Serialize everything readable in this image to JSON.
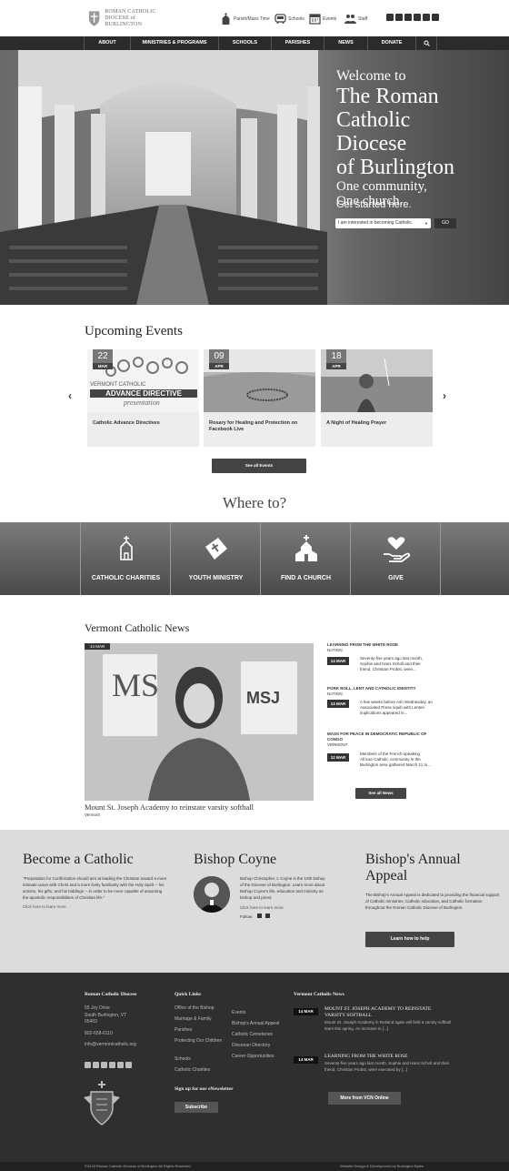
{
  "header": {
    "logo_line1": "ROMAN CATHOLIC",
    "logo_line2": "DIOCESE of BURLINGTON",
    "links": [
      {
        "label": "Parish/Mass Time"
      },
      {
        "label": "Schools"
      },
      {
        "label": "Events"
      },
      {
        "label": "Staff"
      }
    ],
    "social": [
      "youtube-icon",
      "vimeo-icon",
      "instagram-icon",
      "twitter-icon",
      "facebook-icon",
      "flickr-icon"
    ]
  },
  "nav": {
    "items": [
      "ABOUT",
      "MINISTRIES & PROGRAMS",
      "SCHOOLS",
      "PARISHES",
      "NEWS",
      "DONATE"
    ],
    "search_icon": "search-icon"
  },
  "hero": {
    "welcome_to": "Welcome to",
    "line_the_roman": "The Roman",
    "line_catholic": "Catholic",
    "line_diocese": "Diocese",
    "line_of_burlington": "of Burlington",
    "line_community": "One community,",
    "line_church": "One church.",
    "get_started": "Get started here.",
    "select_value": "I am interested in becoming Catholic.",
    "go_label": "GO"
  },
  "events": {
    "title": "Upcoming Events",
    "cards": [
      {
        "day": "22",
        "month": "MAR",
        "title": "Catholic Advance Directives",
        "img_line1": "VERMONT CATHOLIC",
        "img_line2": "ADVANCE DIRECTIVE",
        "img_line3": "presentation"
      },
      {
        "day": "09",
        "month": "APR",
        "title": "Rosary for Healing and Protection on Facebook Live"
      },
      {
        "day": "18",
        "month": "APR",
        "title": "A Night of Healing Prayer"
      }
    ],
    "see_all": "See all Events"
  },
  "where": {
    "title": "Where to?",
    "items": [
      {
        "label": "CATHOLIC CHARITIES",
        "icon": "charities-icon"
      },
      {
        "label": "YOUTH MINISTRY",
        "icon": "bible-icon"
      },
      {
        "label": "FIND A CHURCH",
        "icon": "church-icon"
      },
      {
        "label": "GIVE",
        "icon": "give-heart-icon"
      }
    ]
  },
  "news": {
    "title": "Vermont Catholic News",
    "main": {
      "date": "14 MAR",
      "headline": "Mount St. Joseph Academy to reinstate varsity softball",
      "location": "Vermont"
    },
    "side": [
      {
        "title": "LEARNING FROM THE WHITE ROSE",
        "location": "NATION",
        "date": "14 MAR",
        "text": "Seventy-five years ago last month, Sophie and Hans Scholl and their friend, Christian Probst, were..."
      },
      {
        "title": "PORK ROLL, LENT AND CATHOLIC IDENTITY",
        "location": "NATION",
        "date": "13 MAR",
        "text": "A few weeks before Ash Wednesday, an Associated Press squib with Lenten implications appeared in..."
      },
      {
        "title": "MASS FOR PEACE IN DEMOCRATIC REPUBLIC OF CONGO",
        "location": "VERMONT",
        "date": "12 MAR",
        "text": "Members of the French-speaking African Catholic community in the Burlington area gathered March 11 to..."
      }
    ],
    "see_all": "See all News"
  },
  "become": {
    "title": "Become a Catholic",
    "text": "\"Preparation for Confirmation should aim at leading the Christian toward a more intimate union with Christ and a more lively familiarity with the Holy Spirit -- his actions, his gifts, and his biddings -- in order to be more capable of assuming the apostolic responsibilities of Christian life.\"",
    "link": "Click here to learn more"
  },
  "bishop": {
    "title": "Bishop Coyne",
    "text": "Bishop Christopher J. Coyne is the 10th bishop of the Diocese of Burlington. Learn more about Bishop Coyne's life, education and ministry as bishop and priest.",
    "link": "Click here to learn more",
    "follow": "Follow:"
  },
  "appeal": {
    "title_line1": "Bishop's Annual",
    "title_line2": "Appeal",
    "text": "The Bishop's Annual Appeal is dedicated to providing the financial support of Catholic ministries, Catholic education, and Catholic formation throughout the Roman Catholic Diocese of Burlington.",
    "button": "Learn how to help"
  },
  "footer": {
    "org_title": "Roman Catholic Diocese",
    "address1": "55 Joy Drive",
    "address2": "South Burlington, VT",
    "address3": "05403",
    "phone": "802-658-6110",
    "email": "info@vermontcatholic.org",
    "quick_title": "Quick Links",
    "quick_col1": [
      "Office of the Bishop",
      "Marriage & Family",
      "Parishes",
      "Protecting Our Children",
      "Schools",
      "Catholic Charities"
    ],
    "quick_col2": [
      "Events",
      "Bishop's Annual Appeal",
      "Catholic Cemeteries",
      "Diocesan Directory",
      "Career Opportunities"
    ],
    "newsletter_title": "Sign up for our eNewsletter",
    "subscribe": "Subscribe",
    "vcn_title": "Vermont Catholic News",
    "vcn_items": [
      {
        "date": "14 MAR",
        "title": "MOUNT ST. JOSEPH ACADEMY TO REINSTATE VARSITY SOFTBALL",
        "text": "Mount St. Joseph Academy in Rutland again will field a varsity softball team this spring.  An increase in [...]"
      },
      {
        "date": "14 MAR",
        "title": "LEARNING FROM THE WHITE ROSE",
        "text": "Seventy-five years ago last month, Sophie and Hans Scholl and their friend, Christian Probst, were executed by [...]"
      }
    ],
    "more_vcn": "More from VCN Online",
    "copyright": "©2018 Roman Catholic Diocese of Burlington All Rights Reserved",
    "credit": "Website Design & Development by Burlington Bytes"
  }
}
